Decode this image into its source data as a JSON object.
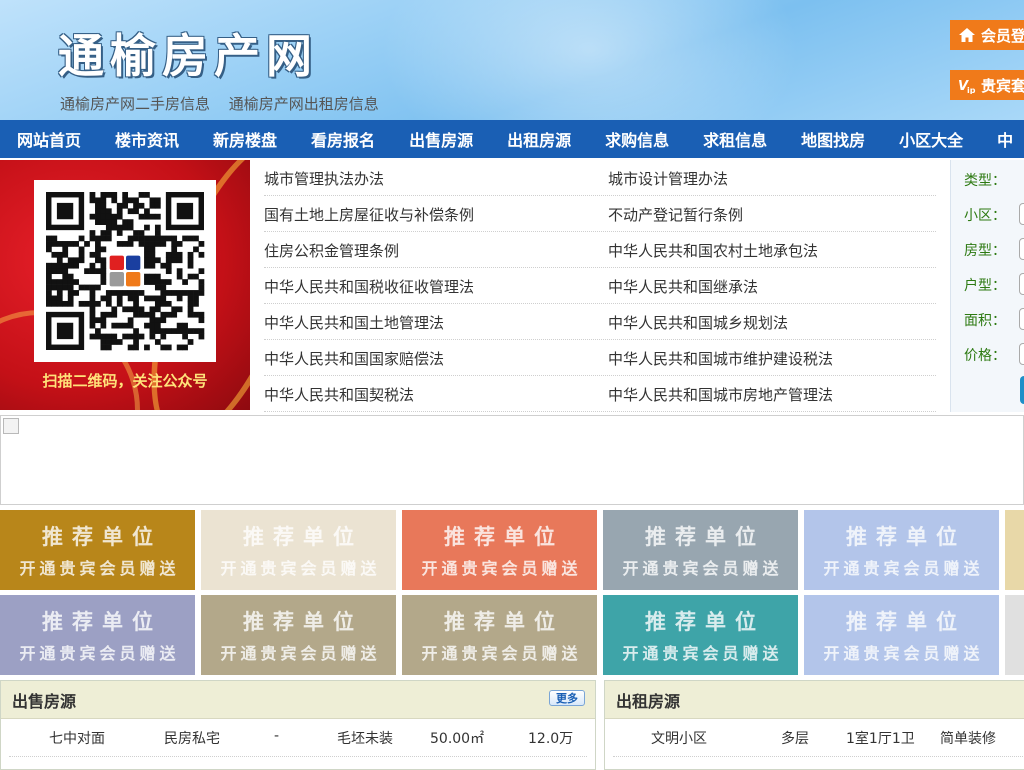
{
  "header": {
    "site_title": "通榆房产网",
    "sublinks": [
      "通榆房产网二手房信息",
      "通榆房产网出租房信息"
    ],
    "login_button": "会员登",
    "vip_button": "贵宾套"
  },
  "nav": [
    "网站首页",
    "楼市资讯",
    "新房楼盘",
    "看房报名",
    "出售房源",
    "出租房源",
    "求购信息",
    "求租信息",
    "地图找房",
    "小区大全",
    "中"
  ],
  "qr": {
    "caption": "扫描二维码，关注公众号"
  },
  "laws": [
    [
      "城市管理执法办法",
      "城市设计管理办法"
    ],
    [
      "国有土地上房屋征收与补偿条例",
      "不动产登记暂行条例"
    ],
    [
      "住房公积金管理条例",
      "中华人民共和国农村土地承包法"
    ],
    [
      "中华人民共和国税收征收管理法",
      "中华人民共和国继承法"
    ],
    [
      "中华人民共和国土地管理法",
      "中华人民共和国城乡规划法"
    ],
    [
      "中华人民共和国国家赔偿法",
      "中华人民共和国城市维护建设税法"
    ],
    [
      "中华人民共和国契税法",
      "中华人民共和国城市房地产管理法"
    ]
  ],
  "search": {
    "labels": [
      "类型：",
      "小区：",
      "房型：",
      "户型：",
      "面积：",
      "价格："
    ]
  },
  "recommend": {
    "line1": "推荐单位",
    "line2": "开通贵宾会员赠送",
    "colors": [
      "#b8861a",
      "#ebe3d2",
      "#e8785a",
      "#98a6b0",
      "#b3c5ea",
      "#e8d8a8",
      "#9ca0c4",
      "#b3a88a",
      "#b3a88a",
      "#3ea4a8",
      "#b3c5ea",
      "#e0e0e0"
    ]
  },
  "sale": {
    "title": "出售房源",
    "more_label": "更多",
    "rows": [
      [
        "七中对面",
        "民房私宅",
        "-",
        "毛坯未装",
        "50.00㎡",
        "12.0万"
      ]
    ]
  },
  "rent": {
    "title": "出租房源",
    "rows": [
      [
        "文明小区",
        "多层",
        "1室1厅1卫",
        "简单装修"
      ]
    ]
  }
}
